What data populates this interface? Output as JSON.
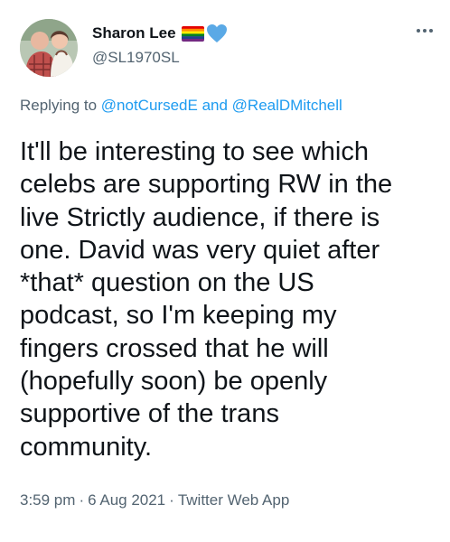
{
  "user": {
    "display_name": "Sharon Lee",
    "handle": "@SL1970SL",
    "badges": [
      "rainbow-flag-icon",
      "blue-heart-icon"
    ]
  },
  "more_icon": "ellipsis-icon",
  "reply": {
    "prefix": "Replying to",
    "mention_1": "@notCursedE",
    "joiner": "and",
    "mention_2": "@RealDMitchell"
  },
  "tweet": {
    "lines": [
      "It'll be interesting to see which",
      "celebs are supporting RW in the",
      "live Strictly audience, if there is",
      "one. David was very quiet after",
      "*that* question on the US",
      "podcast, so I'm keeping my",
      "fingers crossed that he will",
      "(hopefully soon) be openly",
      "supportive of the trans",
      "community."
    ]
  },
  "meta": {
    "time": "3:59 pm",
    "separator": "·",
    "date": "6 Aug 2021",
    "client": "Twitter Web App"
  },
  "colors": {
    "text": "#0f1419",
    "secondary": "#536471",
    "link": "#1d9bf0",
    "heart": "#5aa9e6"
  }
}
